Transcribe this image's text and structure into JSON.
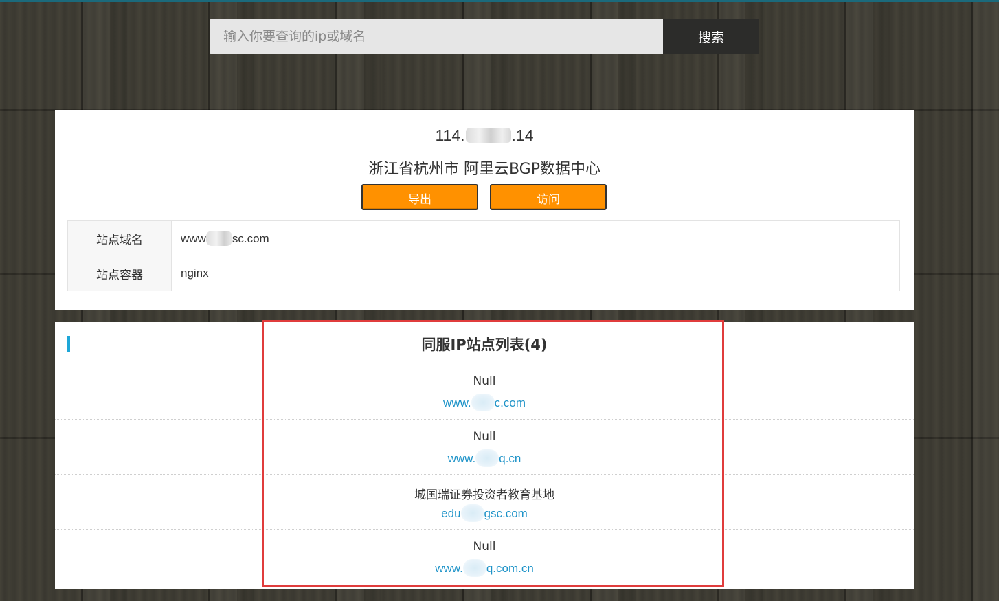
{
  "search": {
    "placeholder": "输入你要查询的ip或域名",
    "value": "",
    "button_label": "搜索"
  },
  "info": {
    "ip_prefix": "114.",
    "ip_suffix": ".14",
    "location": "浙江省杭州市 阿里云BGP数据中心",
    "export_label": "导出",
    "visit_label": "访问",
    "rows": [
      {
        "key": "站点域名",
        "value_prefix": "www",
        "value_suffix": "sc.com"
      },
      {
        "key": "站点容器",
        "value": "nginx"
      }
    ]
  },
  "same_ip": {
    "title": "同服IP站点列表(4)",
    "sites": [
      {
        "name": "Null",
        "domain_prefix": "www.",
        "domain_suffix": "c.com"
      },
      {
        "name": "Null",
        "domain_prefix": "www.",
        "domain_suffix": "q.cn"
      },
      {
        "name": "城国瑞证券投资者教育基地",
        "domain_prefix": "edu",
        "domain_suffix": "gsc.com"
      },
      {
        "name": "Null",
        "domain_prefix": "www.",
        "domain_suffix": "q.com.cn"
      }
    ]
  },
  "colors": {
    "accent": "#1ea7d8",
    "button_orange": "#ff9100",
    "link": "#1e93c8",
    "highlight_border": "#e03c3c"
  }
}
